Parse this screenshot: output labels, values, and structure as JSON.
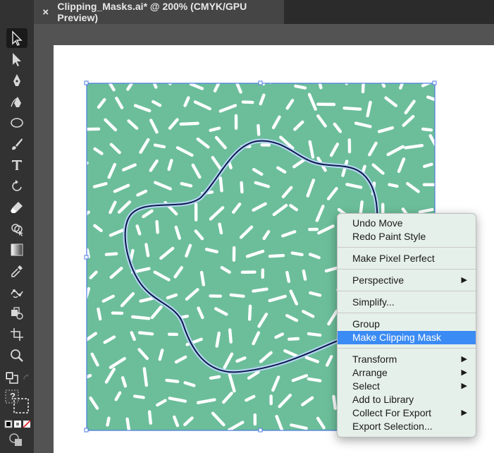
{
  "document": {
    "tab_title": "Clipping_Masks.ai* @ 200% (CMYK/GPU Preview)",
    "close_glyph": "×"
  },
  "toolbar": {
    "tools": [
      "selection-tool",
      "direct-selection-tool",
      "pen-tool",
      "curvature-tool",
      "ellipse-tool",
      "paintbrush-tool",
      "type-tool",
      "rotate-tool",
      "eraser-tool",
      "shape-builder-tool",
      "gradient-tool",
      "eyedropper-tool",
      "puppet-warp-tool",
      "live-paint-tool",
      "artboard-tool",
      "zoom-tool"
    ],
    "active_tool": "selection-tool",
    "help_glyph": "?"
  },
  "colors": {
    "pattern_fill": "#6cbe9a",
    "sprinkle": "#ffffff",
    "selection": "#4a7be0",
    "path_stroke": "#0a1a4a",
    "menu_highlight": "#3b8bf4"
  },
  "context_menu": {
    "groups": [
      [
        {
          "label": "Undo Move"
        },
        {
          "label": "Redo Paint Style"
        }
      ],
      [
        {
          "label": "Make Pixel Perfect"
        }
      ],
      [
        {
          "label": "Perspective",
          "submenu": true
        }
      ],
      [
        {
          "label": "Simplify..."
        }
      ],
      [
        {
          "label": "Group"
        },
        {
          "label": "Make Clipping Mask",
          "highlighted": true
        }
      ],
      [
        {
          "label": "Transform",
          "submenu": true
        },
        {
          "label": "Arrange",
          "submenu": true
        },
        {
          "label": "Select",
          "submenu": true
        },
        {
          "label": "Add to Library"
        },
        {
          "label": "Collect For Export",
          "submenu": true
        },
        {
          "label": "Export Selection..."
        }
      ]
    ]
  }
}
